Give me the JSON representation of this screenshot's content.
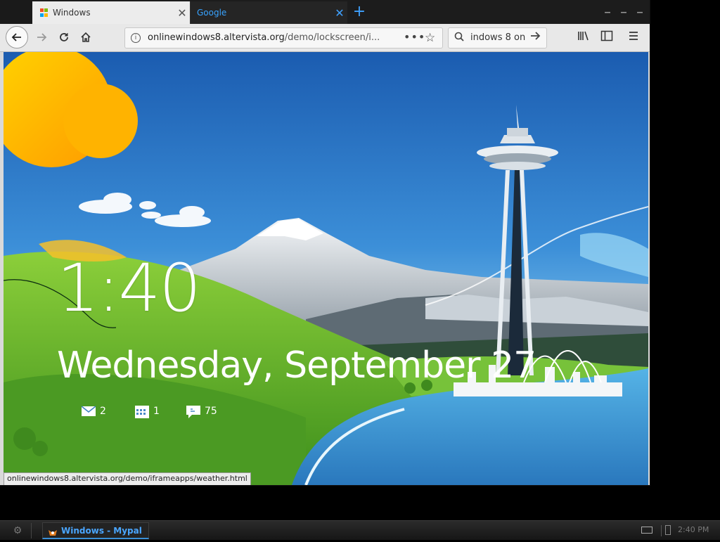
{
  "browser": {
    "tabs": [
      {
        "label": "Windows",
        "active": true
      },
      {
        "label": "Google",
        "active": false
      }
    ],
    "new_tab_icon": "plus-icon",
    "window_controls": [
      "minimize-icon",
      "maximize-icon",
      "close-icon"
    ],
    "url": {
      "host": "onlinewindows8.altervista.org",
      "path": "/demo/lockscreen/i..."
    },
    "search_text": "indows 8 on",
    "toolbar_icons": [
      "back-arrow-icon",
      "forward-arrow-icon",
      "reload-icon",
      "home-icon",
      "info-icon",
      "page-actions-icon",
      "bookmark-star-icon",
      "search-icon",
      "go-arrow-icon",
      "library-icon",
      "sidebar-icon",
      "menu-icon"
    ],
    "status_url": "onlinewindows8.altervista.org/demo/iframeapps/weather.html"
  },
  "lockscreen": {
    "time": "1:40",
    "date": "Wednesday, September 27",
    "notifications": [
      {
        "icon": "mail-icon",
        "count": "2"
      },
      {
        "icon": "calendar-icon",
        "count": "1"
      },
      {
        "icon": "messaging-icon",
        "count": "75"
      }
    ],
    "colors": {
      "sky_top": "#1a5fb3",
      "sky_bottom": "#6fc3ee",
      "grass": "#5fae2a",
      "sun": "#ffc400",
      "water": "#3c97d0"
    }
  },
  "taskbar": {
    "task_label": "Windows - Mypal",
    "clock": "2:40 PM",
    "accent": "#3a8fd6"
  }
}
